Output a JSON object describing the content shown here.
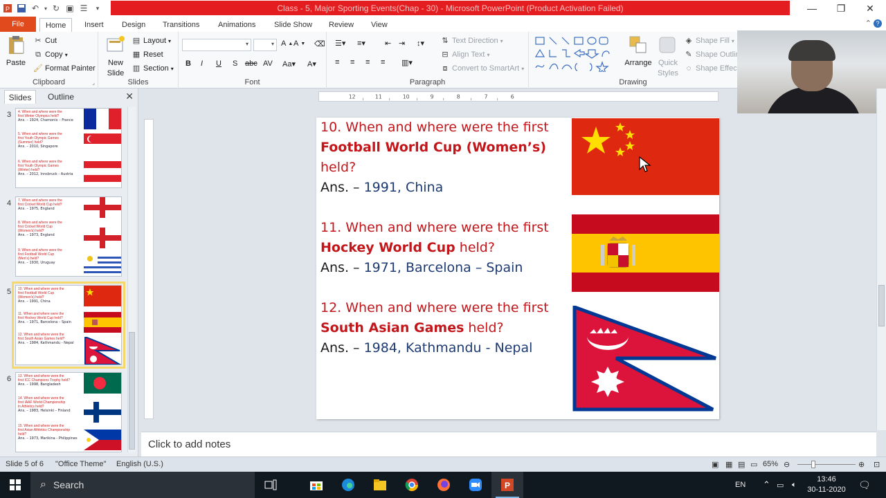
{
  "window": {
    "title": "Class - 5, Major Sporting Events(Chap - 30)  -  Microsoft PowerPoint (Product Activation Failed)"
  },
  "tabs": [
    "File",
    "Home",
    "Insert",
    "Design",
    "Transitions",
    "Animations",
    "Slide Show",
    "Review",
    "View"
  ],
  "ribbon": {
    "clipboard": {
      "paste": "Paste",
      "cut": "Cut",
      "copy": "Copy",
      "format_painter": "Format Painter",
      "label": "Clipboard"
    },
    "slides": {
      "new_slide_line1": "New",
      "new_slide_line2": "Slide",
      "layout": "Layout",
      "reset": "Reset",
      "section": "Section",
      "label": "Slides"
    },
    "font": {
      "label": "Font"
    },
    "paragraph": {
      "text_direction": "Text Direction",
      "align_text": "Align Text",
      "convert_smartart": "Convert to SmartArt",
      "label": "Paragraph"
    },
    "drawing": {
      "arrange": "Arrange",
      "quick_styles_line1": "Quick",
      "quick_styles_line2": "Styles",
      "shape_fill": "Shape Fill",
      "shape_outline": "Shape Outline",
      "shape_effects": "Shape Effects",
      "label": "Drawing"
    }
  },
  "panel": {
    "tab_slides": "Slides",
    "tab_outline": "Outline",
    "thumbnails": [
      {
        "number": "3",
        "lines": [
          {
            "text": "4. When and where were the",
            "type": "q"
          },
          {
            "text": "first Winter Olympics held?",
            "type": "q"
          },
          {
            "text": "Ans. – 1924, Chamonix – France",
            "type": "a"
          },
          {
            "text": "5. When and where were the",
            "type": "q"
          },
          {
            "text": "first Youth Olympic Games",
            "type": "q"
          },
          {
            "text": "(Summer) held?",
            "type": "q"
          },
          {
            "text": "Ans. – 2010, Singapore",
            "type": "a"
          },
          {
            "text": "6. When and where were the",
            "type": "q"
          },
          {
            "text": "first Youth Olympic Games",
            "type": "q"
          },
          {
            "text": "(Winter) held?",
            "type": "q"
          },
          {
            "text": "Ans. – 2012, Innsbruck - Austria",
            "type": "a"
          }
        ]
      },
      {
        "number": "4",
        "lines": [
          {
            "text": "7. When and where were the",
            "type": "q"
          },
          {
            "text": "first Cricket World Cup held?",
            "type": "q"
          },
          {
            "text": "Ans. – 1975, England",
            "type": "a"
          },
          {
            "text": "8. When and where were the",
            "type": "q"
          },
          {
            "text": "first Cricket World Cup",
            "type": "q"
          },
          {
            "text": "(Women's) held?",
            "type": "q"
          },
          {
            "text": "Ans. – 1973, England",
            "type": "a"
          },
          {
            "text": "9. When and where were the",
            "type": "q"
          },
          {
            "text": "first Football World Cup",
            "type": "q"
          },
          {
            "text": "(Men's) held?",
            "type": "q"
          },
          {
            "text": "Ans. – 1930, Uruguay",
            "type": "a"
          }
        ]
      },
      {
        "number": "5",
        "lines": [
          {
            "text": "10. When and where were the",
            "type": "q"
          },
          {
            "text": "first Football World Cup",
            "type": "q"
          },
          {
            "text": "(Women's) held?",
            "type": "q"
          },
          {
            "text": "Ans. – 1991, China",
            "type": "a"
          },
          {
            "text": "11. When and where were the",
            "type": "q"
          },
          {
            "text": "first Hockey World Cup held?",
            "type": "q"
          },
          {
            "text": "Ans. – 1971, Barcelona – Spain",
            "type": "a"
          },
          {
            "text": "12. When and where were the",
            "type": "q"
          },
          {
            "text": "first South Asian Games held?",
            "type": "q"
          },
          {
            "text": "Ans. – 1984, Kathmandu - Nepal",
            "type": "a"
          }
        ]
      },
      {
        "number": "6",
        "lines": [
          {
            "text": "13. When and where were the",
            "type": "q"
          },
          {
            "text": "first ICC Champions Trophy held?",
            "type": "q"
          },
          {
            "text": "Ans. – 1998, Bangladesh",
            "type": "a"
          },
          {
            "text": "14. When and where were the",
            "type": "q"
          },
          {
            "text": "first IAAF World Championship",
            "type": "q"
          },
          {
            "text": "in Athletics held?",
            "type": "q"
          },
          {
            "text": "Ans. – 1983, Helsinki – Finland",
            "type": "a"
          },
          {
            "text": "15. When and where were the",
            "type": "q"
          },
          {
            "text": "first Asian Athletics Championship",
            "type": "q"
          },
          {
            "text": "held?",
            "type": "q"
          },
          {
            "text": "Ans. – 1973, Marikina - Philippines",
            "type": "a"
          }
        ]
      }
    ]
  },
  "slide": {
    "items": [
      {
        "q_prefix": "10. When and where were the first ",
        "q_bold": "Football World Cup (Women’s)",
        "q_suffix": " held?",
        "ans_label": "Ans. – ",
        "ans_value": "1991, China"
      },
      {
        "q_prefix": "11. When and where were the first ",
        "q_bold": "Hockey World Cup",
        "q_suffix": " held?",
        "ans_label": "Ans. – ",
        "ans_value": "1971, Barcelona – Spain"
      },
      {
        "q_prefix": "12. When and where were the first ",
        "q_bold": "South Asian Games",
        "q_suffix": " held?",
        "ans_label": "Ans. – ",
        "ans_value": "1984, Kathmandu - Nepal"
      }
    ]
  },
  "notes": {
    "placeholder": "Click to add notes"
  },
  "status": {
    "slide_of": "Slide 5 of 6",
    "theme": "\"Office Theme\"",
    "language": "English (U.S.)",
    "zoom": "65%"
  },
  "taskbar": {
    "search": "Search",
    "lang": "EN",
    "time": "13:46",
    "date": "30-11-2020"
  },
  "colors": {
    "title_red": "#e41d20",
    "question_red": "#c3161b",
    "answer_blue": "#1d3a72",
    "file_tab": "#e04a1c"
  }
}
